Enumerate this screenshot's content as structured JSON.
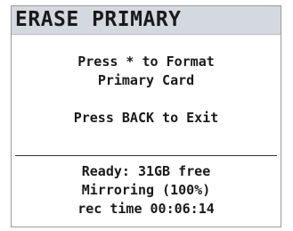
{
  "header": {
    "title": "ERASE PRIMARY"
  },
  "message": {
    "line1": "Press * to Format",
    "line2": "Primary Card",
    "line3": "Press BACK to Exit"
  },
  "status": {
    "ready": "Ready: 31GB free",
    "mirroring": "Mirroring (100%)",
    "rec_time": "rec time 00:06:14"
  },
  "colors": {
    "title_bar_bg": "#d4d9e0",
    "text": "#1a1a1a",
    "background": "#ffffff"
  }
}
